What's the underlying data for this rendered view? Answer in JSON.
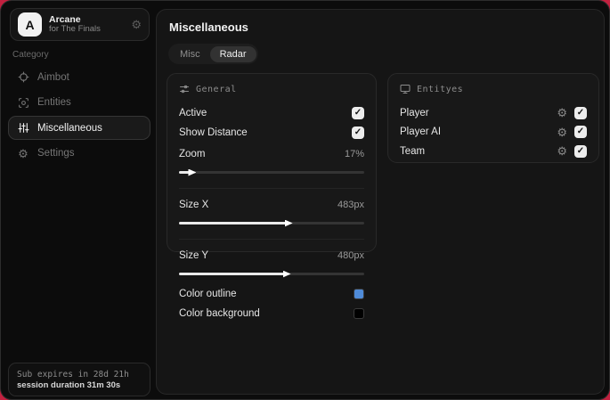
{
  "app": {
    "name": "Arcane",
    "subtitle": "for The Finals",
    "avatar_letter": "A"
  },
  "sidebar": {
    "category_label": "Category",
    "items": [
      {
        "label": "Aimbot",
        "icon": "crosshair-icon",
        "active": false
      },
      {
        "label": "Entities",
        "icon": "scan-icon",
        "active": false
      },
      {
        "label": "Miscellaneous",
        "icon": "sliders-icon",
        "active": true
      },
      {
        "label": "Settings",
        "icon": "gear-icon",
        "active": false
      }
    ],
    "footer": {
      "sub_expires": "Sub expires in 28d 21h",
      "session_duration": "session duration 31m 30s"
    }
  },
  "main": {
    "title": "Miscellaneous",
    "tabs": [
      {
        "label": "Misc",
        "active": false
      },
      {
        "label": "Radar",
        "active": true
      }
    ],
    "panels": {
      "general": {
        "title": "General",
        "rows": [
          {
            "type": "checkbox",
            "label": "Active",
            "checked": true
          },
          {
            "type": "checkbox",
            "label": "Show Distance",
            "checked": true
          },
          {
            "type": "slider",
            "label": "Zoom",
            "value": "17%",
            "percent": 6
          },
          {
            "type": "slider",
            "label": "Size X",
            "value": "483px",
            "percent": 58
          },
          {
            "type": "slider",
            "label": "Size Y",
            "value": "480px",
            "percent": 57
          },
          {
            "type": "color",
            "label": "Color outline",
            "color": "#4f8bd8"
          },
          {
            "type": "color",
            "label": "Color background",
            "color": "#000000"
          }
        ]
      },
      "entities": {
        "title": "Entityes",
        "rows": [
          {
            "label": "Player",
            "checked": true
          },
          {
            "label": "Player AI",
            "checked": true
          },
          {
            "label": "Team",
            "checked": true
          }
        ]
      }
    }
  },
  "colors": {
    "desktop_background": "#c2203f",
    "outline_swatch": "#4f8bd8",
    "background_swatch": "#000000"
  }
}
